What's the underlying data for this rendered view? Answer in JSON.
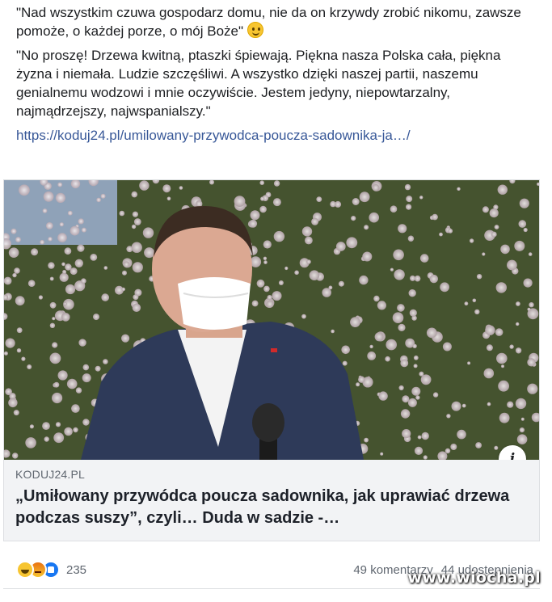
{
  "post": {
    "quote1": "\"Nad wszystkim czuwa gospodarz domu, nie da on krzywdy zrobić nikomu, zawsze pomoże, o każdej porze, o mój Boże\"",
    "quote2": "\"No proszę! Drzewa kwitną, ptaszki śpiewają. Piękna nasza Polska cała, piękna żyzna i niemała. Ludzie szczęśliwi. A wszystko dzięki naszej partii, naszemu genialnemu wodzowi i mnie oczywiście. Jestem jedyny, niepowtarzalny, najmądrzejszy, najwspanialszy.\"",
    "link": "https://koduj24.pl/umilowany-przywodca-poucza-sadownika-ja…/",
    "emoji": "smile-emoji-icon"
  },
  "card": {
    "domain": "KODUJ24.PL",
    "headline": "„Umiłowany przywódca poucza sadownika, jak uprawiać drzewa podczas suszy”, czyli… Duda w sadzie -…",
    "info_icon": "i"
  },
  "stats": {
    "reaction_count": "235",
    "comments": "49 komentarzy",
    "shares": "44 udostępnienia",
    "reaction_icons": [
      "haha-icon",
      "angry-icon",
      "like-icon"
    ]
  },
  "watermark": "www.wiocha.pl",
  "colors": {
    "link": "#385898",
    "card_meta_bg": "#f2f3f5",
    "like_blue": "#1877f2"
  }
}
